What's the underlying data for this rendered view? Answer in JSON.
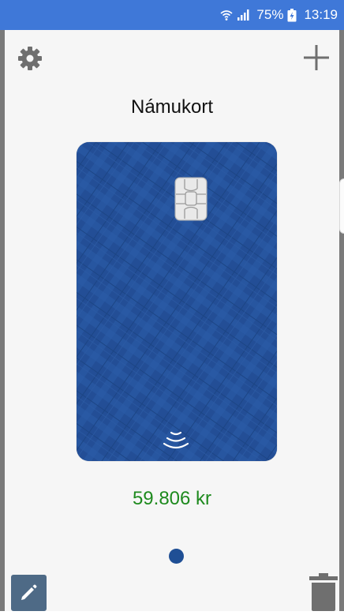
{
  "status_bar": {
    "battery": "75%",
    "time": "13:19",
    "icons": [
      "wifi-icon",
      "signal-icon",
      "battery-icon"
    ]
  },
  "header": {
    "settings_icon": "gear-icon",
    "add_icon": "plus-icon"
  },
  "card": {
    "title": "Námukort",
    "balance": "59.806 kr",
    "color": "#234e96"
  },
  "pager": {
    "current_page": 1,
    "total_pages": 1
  },
  "actions": {
    "edit_icon": "pencil-icon",
    "delete_icon": "trash-icon"
  },
  "colors": {
    "status_bar": "#3f78d8",
    "balance_text": "#1e8a1e",
    "icon_gray": "#6f6f6f"
  }
}
